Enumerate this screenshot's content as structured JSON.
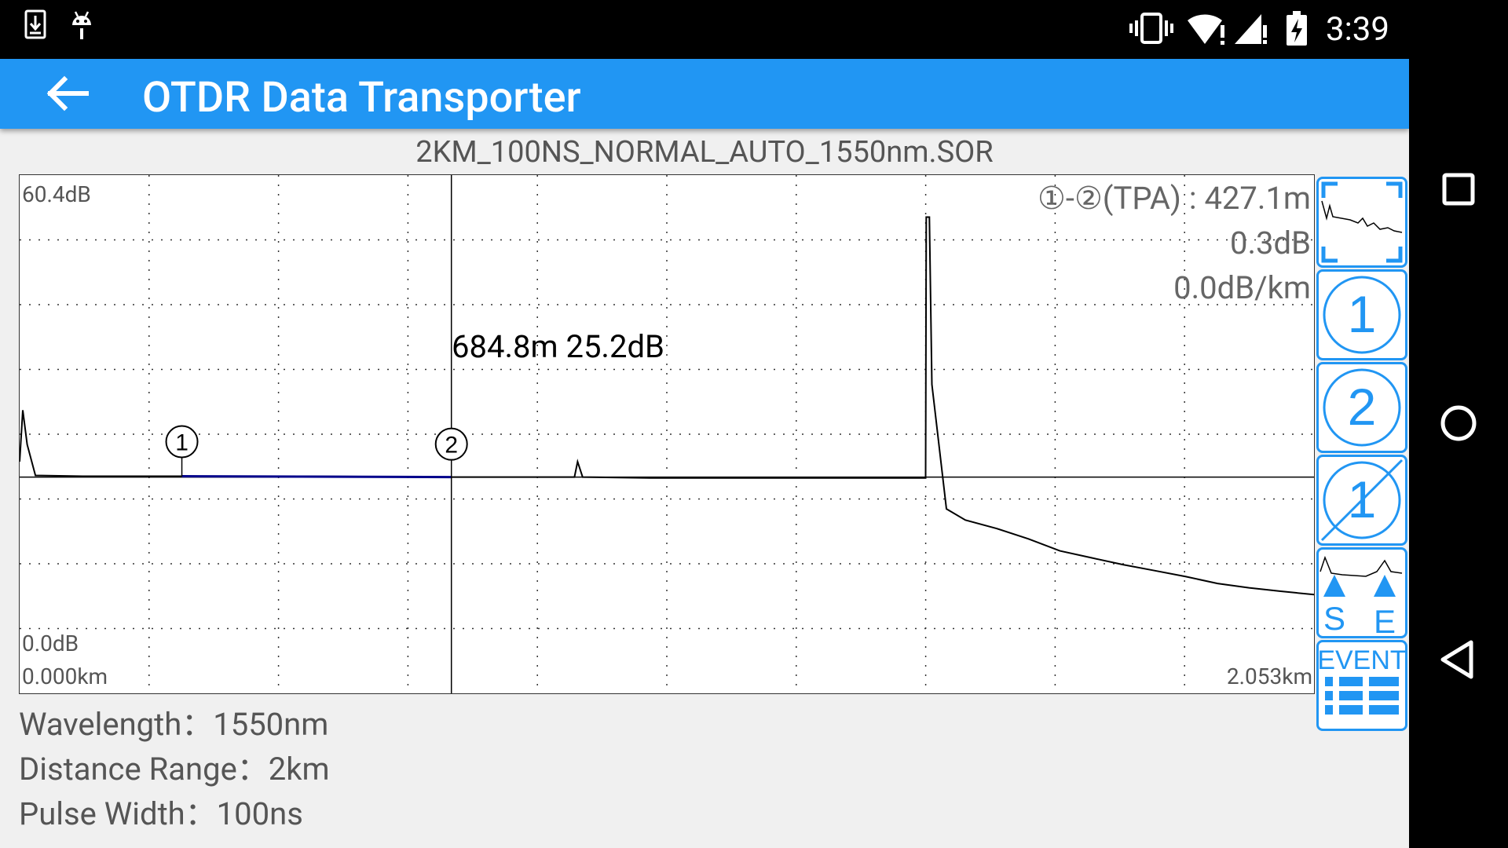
{
  "status_bar": {
    "time": "3:39",
    "icons": [
      "download-icon",
      "android-debug-icon",
      "vibrate-icon",
      "wifi-icon",
      "cellular-signal-icon",
      "battery-charging-icon"
    ]
  },
  "toolbar": {
    "title": "OTDR Data Transporter",
    "back_icon": "arrow-back-icon",
    "color": "#2196f3"
  },
  "file_name": "2KM_100NS_NORMAL_AUTO_1550nm.SOR",
  "chart": {
    "y_max_label": "60.4dB",
    "y_min_label": "0.0dB",
    "x_min_label": "0.000km",
    "x_max_label": "2.053km",
    "marker_readout": "684.8m 25.2dB",
    "marker_1_label": "1",
    "marker_2_label": "2",
    "tpa_distance": "①-②(TPA) : 427.1m",
    "tpa_loss": "0.3dB",
    "tpa_per_km": "0.0dB/km",
    "trace_color": "#000000",
    "marked_segment_color": "#00008b"
  },
  "chart_data": {
    "type": "line",
    "title": "2KM_100NS_NORMAL_AUTO_1550nm.SOR",
    "xlabel": "",
    "ylabel": "",
    "xlim": [
      0,
      2.053
    ],
    "ylim": [
      0,
      60.4
    ],
    "x_unit": "km",
    "y_unit": "dB",
    "grid": true,
    "series": [
      {
        "values": [
          [
            0.0,
            27.0
          ],
          [
            0.005,
            33.0
          ],
          [
            0.012,
            29.0
          ],
          [
            0.025,
            25.4
          ],
          [
            0.1,
            25.3
          ],
          [
            0.257,
            25.3
          ],
          [
            0.4,
            25.3
          ],
          [
            0.6848,
            25.2
          ],
          [
            0.8,
            25.2
          ],
          [
            0.88,
            25.2
          ],
          [
            0.885,
            27.0
          ],
          [
            0.893,
            25.2
          ],
          [
            1.0,
            25.1
          ],
          [
            1.4,
            25.1
          ],
          [
            1.437,
            25.1
          ],
          [
            1.438,
            55.5
          ],
          [
            1.443,
            55.5
          ],
          [
            1.447,
            36.0
          ],
          [
            1.47,
            21.5
          ],
          [
            1.5,
            20.2
          ],
          [
            1.55,
            19.2
          ],
          [
            1.6,
            18.0
          ],
          [
            1.65,
            16.6
          ],
          [
            1.7,
            15.8
          ],
          [
            1.75,
            15.0
          ],
          [
            1.8,
            14.3
          ],
          [
            1.85,
            13.6
          ],
          [
            1.9,
            12.8
          ],
          [
            1.95,
            12.3
          ],
          [
            2.0,
            11.9
          ],
          [
            2.053,
            11.5
          ]
        ]
      }
    ],
    "markers": [
      {
        "label": "1",
        "x": 0.2573,
        "y": 25.3
      },
      {
        "label": "2",
        "x": 0.6848,
        "y": 25.2
      }
    ]
  },
  "tools": [
    {
      "name": "zoom-fit-button",
      "icon": "zoom-fit-trace-icon"
    },
    {
      "name": "marker-1-button",
      "icon": "marker-1-icon",
      "label": "1"
    },
    {
      "name": "marker-2-button",
      "icon": "marker-2-icon",
      "label": "2"
    },
    {
      "name": "clear-marker-button",
      "icon": "clear-marker-icon",
      "label": "1"
    },
    {
      "name": "start-end-button",
      "icon": "start-end-icon",
      "label_s": "S",
      "label_e": "E"
    },
    {
      "name": "event-list-button",
      "icon": "event-list-icon",
      "label": "EVENT"
    }
  ],
  "info": {
    "wavelength": "Wavelength：1550nm",
    "distance_range": "Distance Range：2km",
    "pulse_width": "Pulse Width：100ns"
  },
  "nav_bar": {
    "icons": [
      "recents-icon",
      "home-icon",
      "back-icon"
    ]
  }
}
